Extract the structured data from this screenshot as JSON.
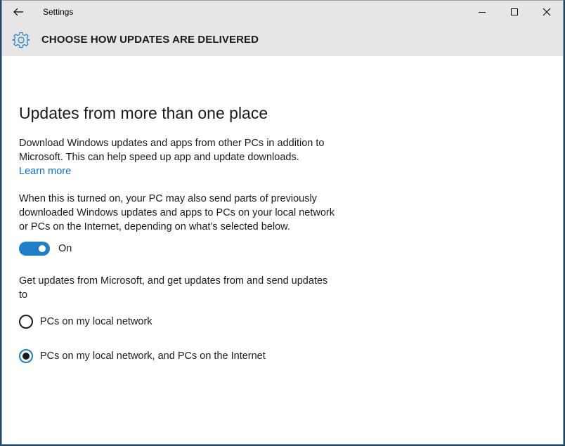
{
  "window": {
    "app_title": "Settings"
  },
  "header": {
    "title": "CHOOSE HOW UPDATES ARE DELIVERED"
  },
  "main": {
    "heading": "Updates from more than one place",
    "description": "Download Windows updates and apps from other PCs in addition to Microsoft. This can help speed up app and update downloads.",
    "learn_more": "Learn more",
    "explanation": "When this is turned on, your PC may also send parts of previously downloaded Windows updates and apps to PCs on your local network or PCs on the Internet, depending on what’s selected below.",
    "toggle": {
      "state": true,
      "label": "On"
    },
    "options_intro": "Get updates from Microsoft, and get updates from and send updates to",
    "options": [
      {
        "label": "PCs on my local network",
        "selected": false
      },
      {
        "label": "PCs on my local network, and PCs on the Internet",
        "selected": true
      }
    ]
  },
  "colors": {
    "accent": "#1f7ec7",
    "link": "#0f6fc6",
    "chrome": "#e6e6e6"
  },
  "icons": [
    "back-arrow-icon",
    "minimize-icon",
    "maximize-icon",
    "close-icon",
    "gear-icon"
  ]
}
